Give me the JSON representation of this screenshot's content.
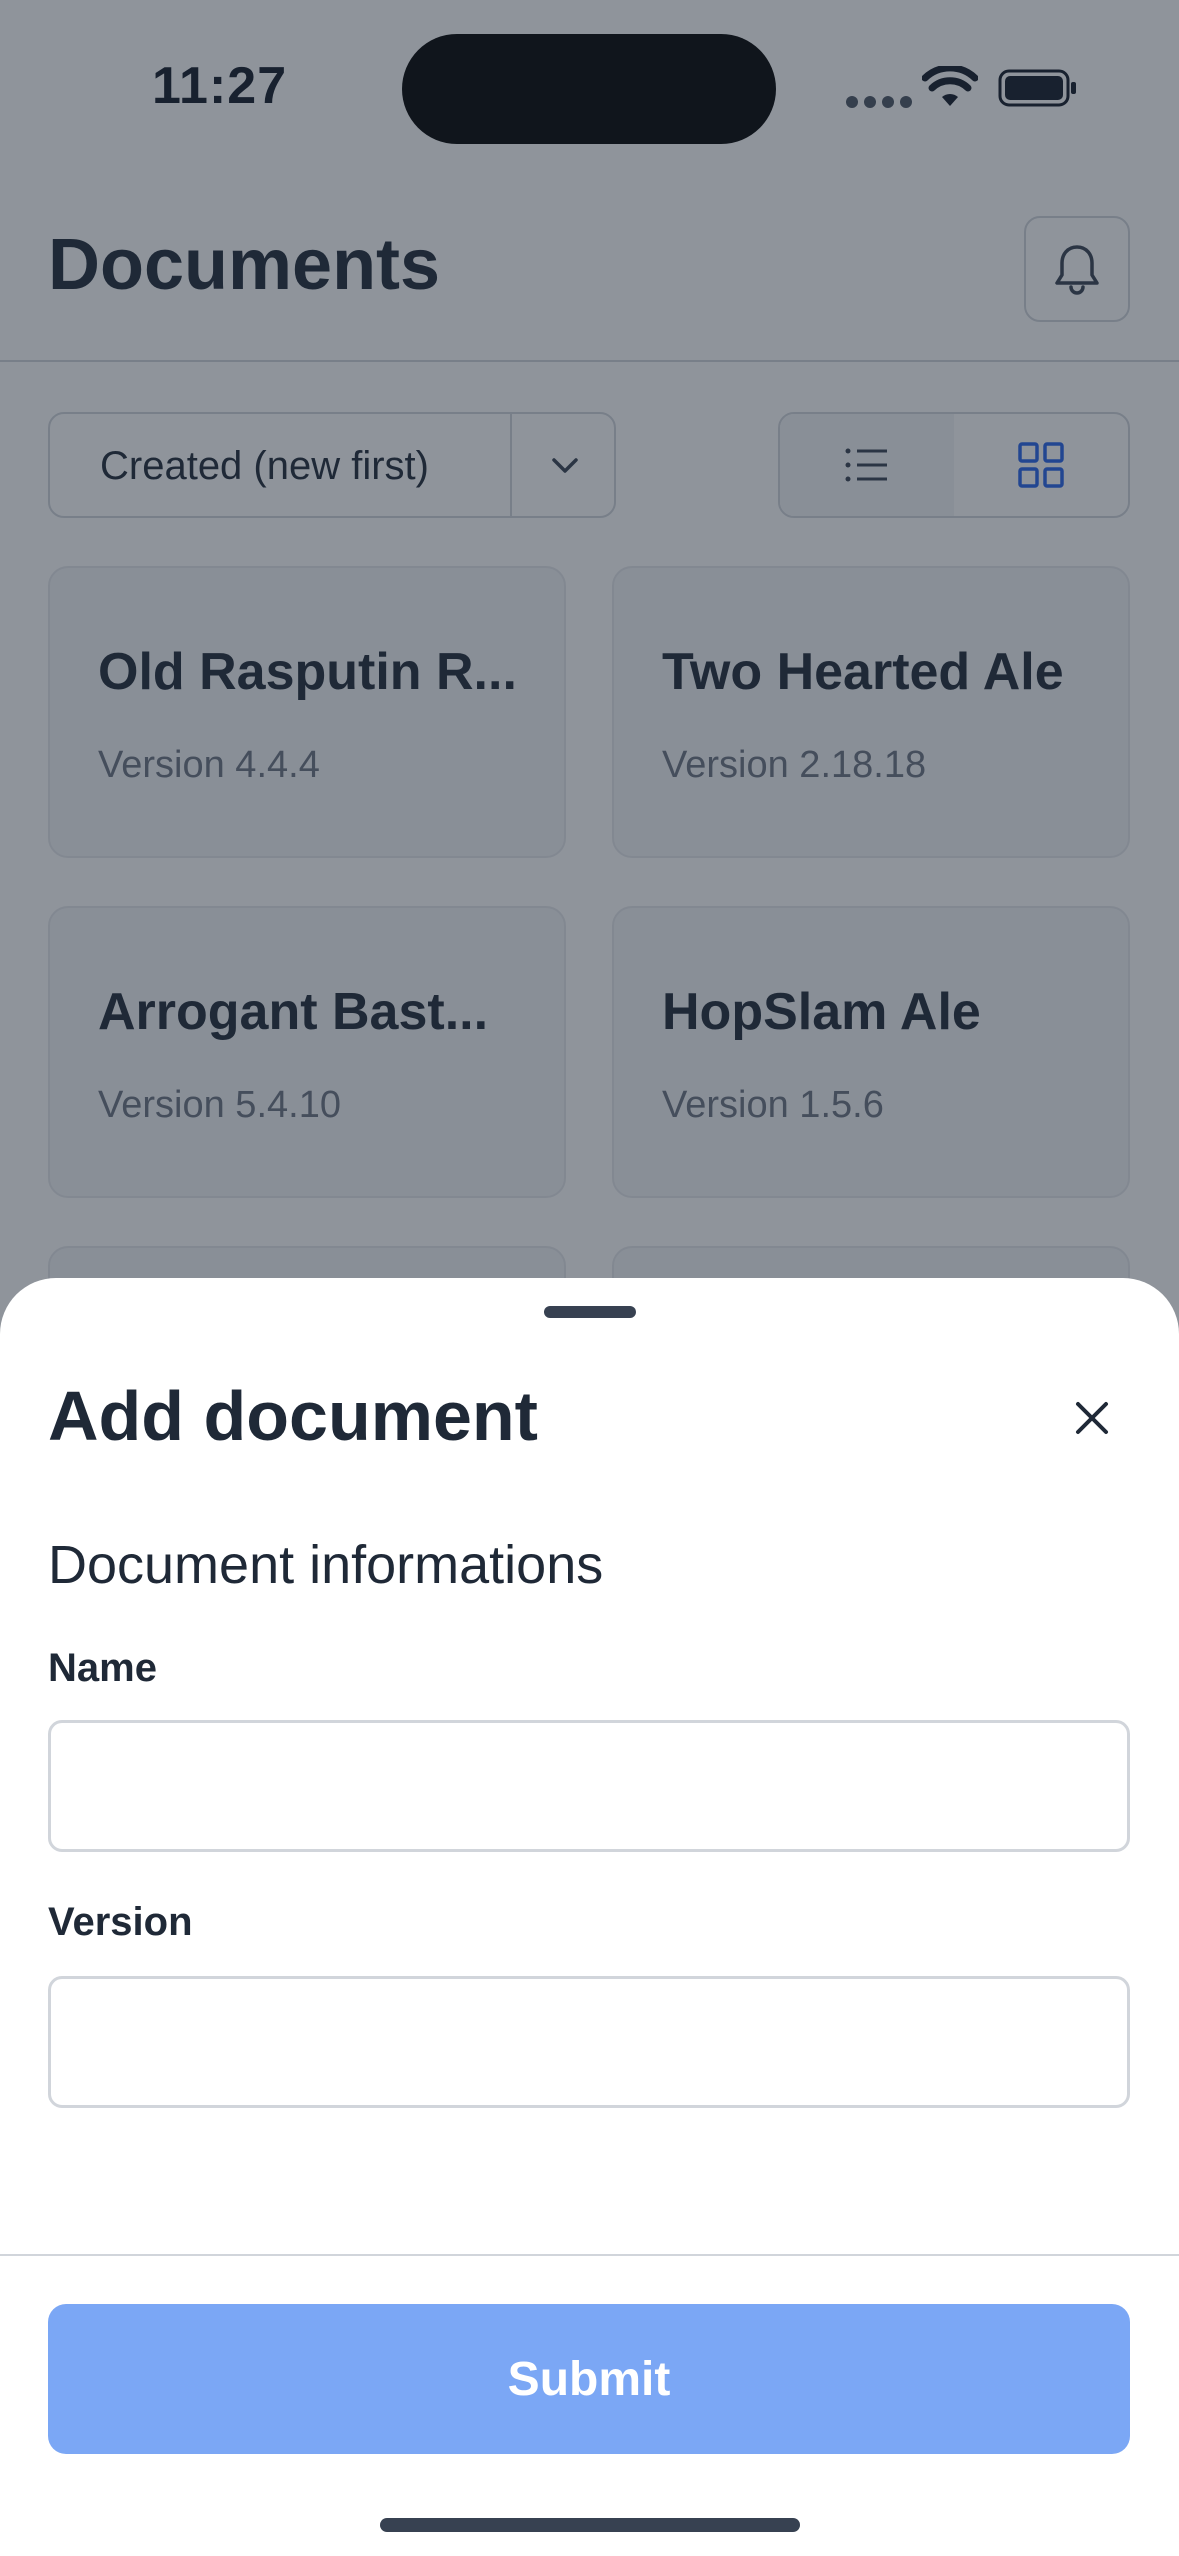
{
  "status_bar": {
    "time": "11:27"
  },
  "header": {
    "title": "Documents"
  },
  "toolbar": {
    "sort_label": "Created (new first)"
  },
  "documents": [
    {
      "name": "Old Rasputin R...",
      "version": "Version 4.4.4"
    },
    {
      "name": "Two Hearted Ale",
      "version": "Version 2.18.18"
    },
    {
      "name": "Arrogant Bast...",
      "version": "Version 5.4.10"
    },
    {
      "name": "HopSlam Ale",
      "version": "Version 1.5.6"
    }
  ],
  "sheet": {
    "title": "Add document",
    "section_title": "Document informations",
    "name_label": "Name",
    "name_value": "",
    "version_label": "Version",
    "version_value": "",
    "submit_label": "Submit"
  },
  "colors": {
    "primary_disabled": "#7ba7f5",
    "accent_blue": "#2563eb"
  }
}
